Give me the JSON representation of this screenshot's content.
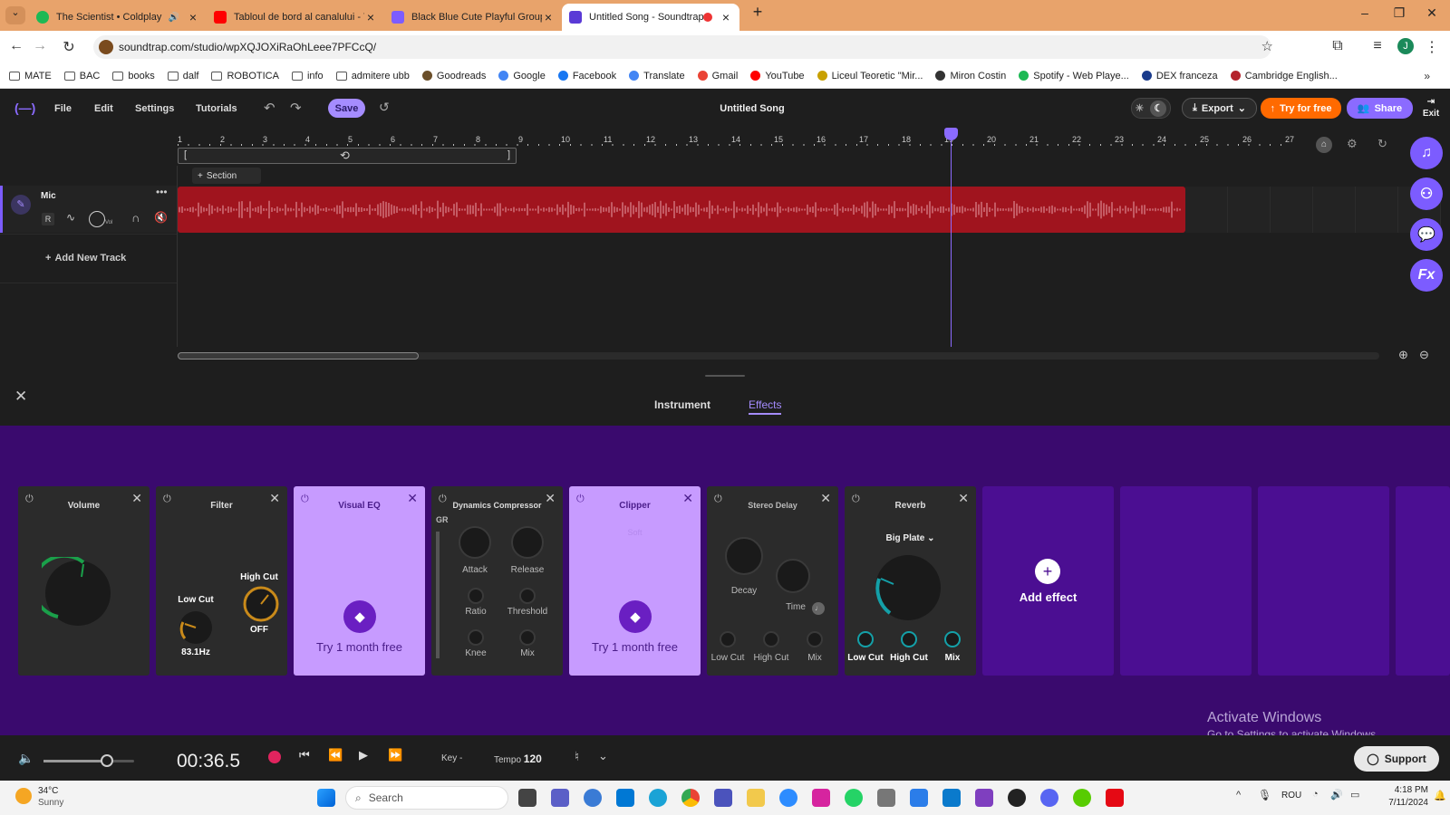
{
  "browser": {
    "tabs": [
      {
        "title": "The Scientist • Coldplay",
        "color": "#1db954",
        "active": false,
        "audio": true
      },
      {
        "title": "Tabloul de bord al canalului - Yo",
        "color": "#ff0000",
        "active": false
      },
      {
        "title": "Black Blue Cute Playful Group P",
        "color": "#7c5cff",
        "active": false
      },
      {
        "title": "Untitled Song - Soundtrap",
        "color": "#5a3ad6",
        "active": true,
        "recording": true
      }
    ],
    "new_tab": "+",
    "url": "soundtrap.com/studio/wpXQJOXiRaOhLeee7PFCcQ/",
    "bookmarks": [
      {
        "label": "MATE",
        "type": "folder"
      },
      {
        "label": "BAC",
        "type": "folder"
      },
      {
        "label": "books",
        "type": "folder"
      },
      {
        "label": "dalf",
        "type": "folder"
      },
      {
        "label": "ROBOTICA",
        "type": "folder"
      },
      {
        "label": "info",
        "type": "folder"
      },
      {
        "label": "admitere ubb",
        "type": "folder"
      },
      {
        "label": "Goodreads",
        "type": "site",
        "color": "#6b4f2a"
      },
      {
        "label": "Google",
        "type": "site",
        "color": "#4285f4"
      },
      {
        "label": "Facebook",
        "type": "site",
        "color": "#1877f2"
      },
      {
        "label": "Translate",
        "type": "site",
        "color": "#4285f4"
      },
      {
        "label": "Gmail",
        "type": "site",
        "color": "#ea4335"
      },
      {
        "label": "YouTube",
        "type": "site",
        "color": "#ff0000"
      },
      {
        "label": "Liceul Teoretic \"Mir...",
        "type": "site",
        "color": "#c8a000"
      },
      {
        "label": "Miron Costin",
        "type": "site",
        "color": "#333333"
      },
      {
        "label": "Spotify - Web Playe...",
        "type": "site",
        "color": "#1db954"
      },
      {
        "label": "DEX franceza",
        "type": "site",
        "color": "#1a3b8c"
      },
      {
        "label": "Cambridge English...",
        "type": "site",
        "color": "#b4232c"
      }
    ]
  },
  "app": {
    "menu": [
      "File",
      "Edit",
      "Settings",
      "Tutorials"
    ],
    "save_label": "Save",
    "song_title": "Untitled Song",
    "export_label": "Export",
    "try_label": "Try for free",
    "share_label": "Share",
    "exit_label": "Exit",
    "ruler_ticks": [
      "1",
      "2",
      "3",
      "4",
      "5",
      "6",
      "7",
      "8",
      "9",
      "10",
      "11",
      "12",
      "13",
      "14",
      "15",
      "16",
      "17",
      "18",
      "19",
      "20",
      "21",
      "22",
      "23",
      "24",
      "25",
      "26",
      "27"
    ],
    "section_label": "Section",
    "track": {
      "name": "Mic",
      "r_label": "R",
      "vol_label": "Vol"
    },
    "add_track_label": "Add New Track",
    "tabs": {
      "instrument": "Instrument",
      "effects": "Effects"
    },
    "effects": {
      "volume": {
        "title": "Volume"
      },
      "filter": {
        "title": "Filter",
        "low_cut": "Low Cut",
        "low_cut_value": "83.1Hz",
        "high_cut": "High Cut",
        "high_cut_value": "OFF"
      },
      "visual_eq": {
        "title": "Visual EQ",
        "promo": "Try 1 month free"
      },
      "compressor": {
        "title": "Dynamics Compressor",
        "gr": "GR",
        "attack": "Attack",
        "release": "Release",
        "ratio": "Ratio",
        "threshold": "Threshold",
        "knee": "Knee",
        "mix": "Mix"
      },
      "clipper": {
        "title": "Clipper",
        "mode": "Soft",
        "promo": "Try 1 month free"
      },
      "stereo_delay": {
        "title": "Stereo Delay",
        "decay": "Decay",
        "time": "Time",
        "low_cut": "Low Cut",
        "high_cut": "High Cut",
        "mix": "Mix"
      },
      "reverb": {
        "title": "Reverb",
        "preset": "Big Plate",
        "low_cut": "Low Cut",
        "high_cut": "High Cut",
        "mix": "Mix"
      },
      "add_effect": "Add effect"
    },
    "watermark": {
      "line1": "Activate Windows",
      "line2": "Go to Settings to activate Windows."
    },
    "transport": {
      "time": "00:36.5",
      "key_label": "Key",
      "key_value": "-",
      "tempo_label": "Tempo",
      "tempo_value": "120",
      "support_label": "Support",
      "volume_level": 0.7
    }
  },
  "taskbar": {
    "weather_temp": "34°C",
    "weather_desc": "Sunny",
    "search_placeholder": "Search",
    "lang": "ROU",
    "time": "4:18 PM",
    "date": "7/11/2024"
  },
  "colors": {
    "accent": "#7c5cff",
    "clip": "#a0141e",
    "fx_bg": "#3a0a6e",
    "pro_card": "#c79bff",
    "orange": "#ff6a00"
  }
}
